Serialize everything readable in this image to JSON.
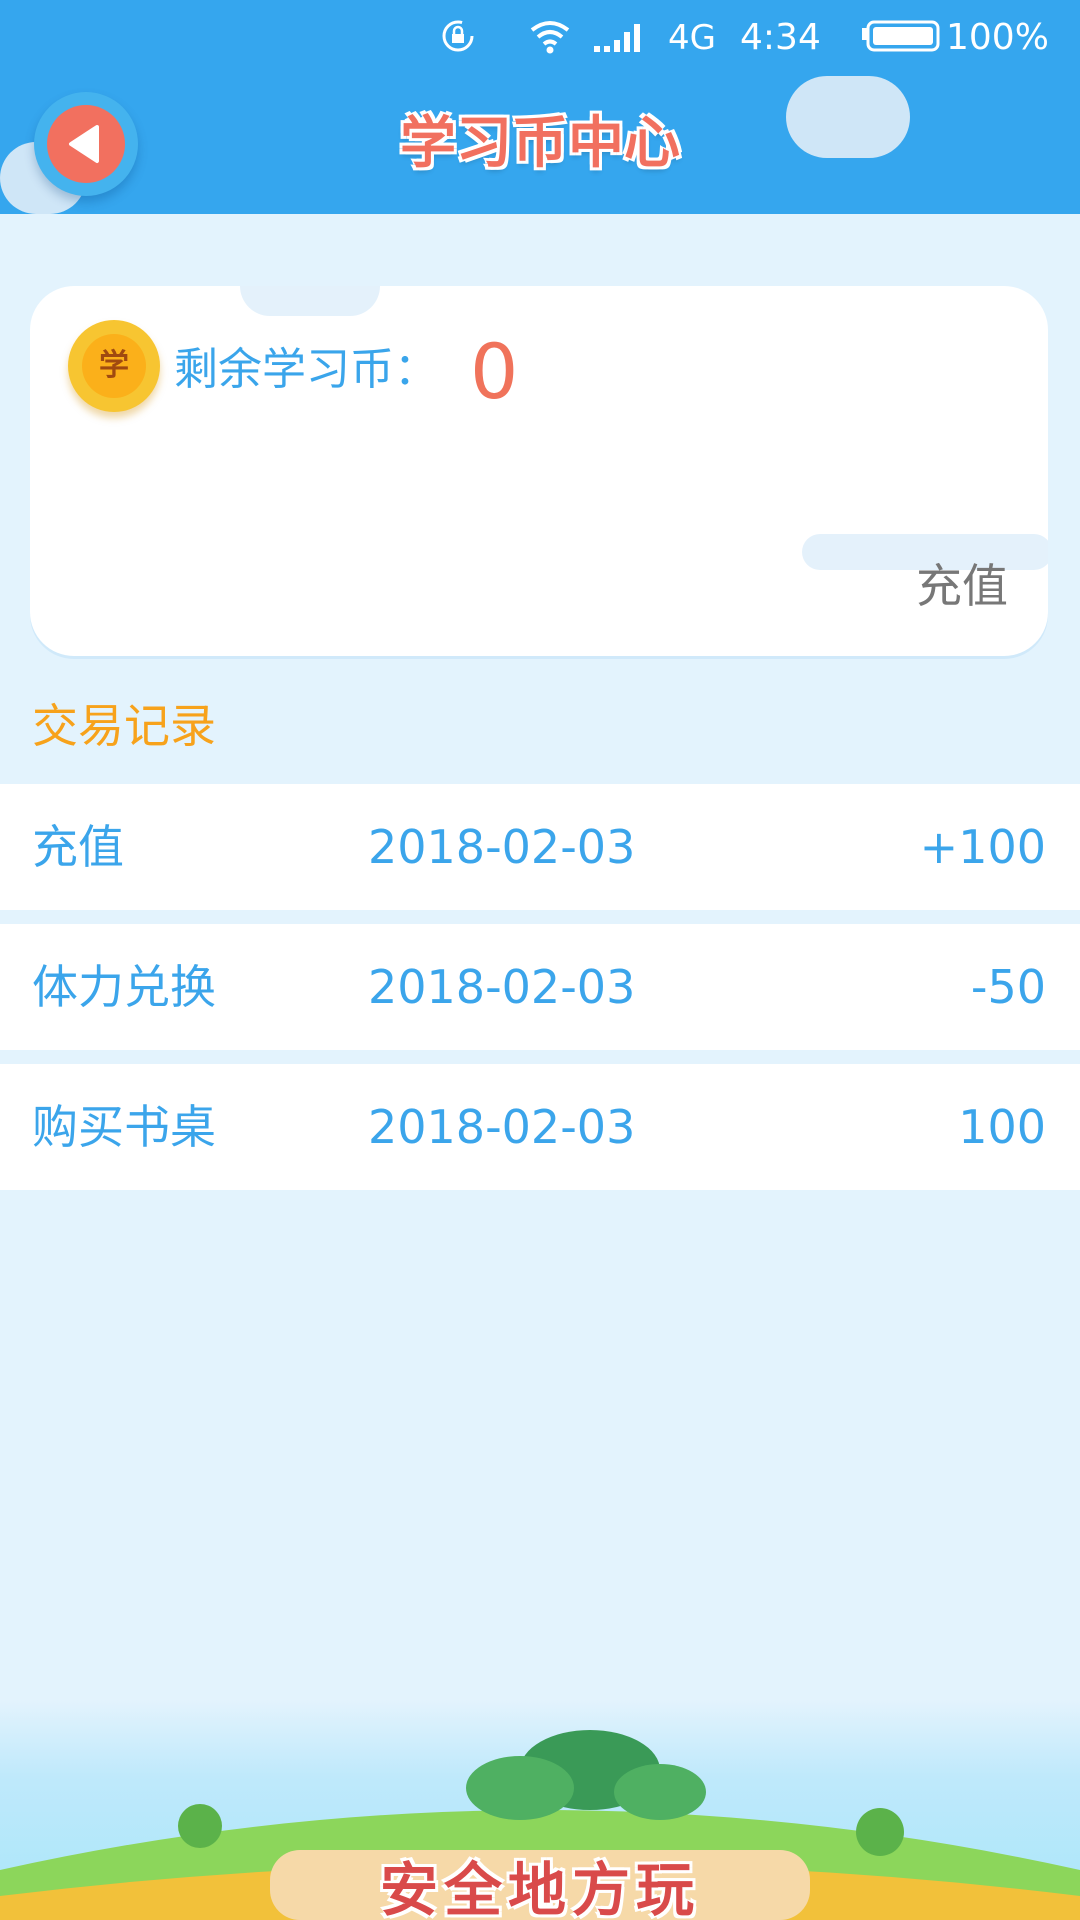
{
  "status_bar": {
    "network": "4G",
    "time": "4:34",
    "battery": "100%"
  },
  "header": {
    "title": "学习币中心"
  },
  "balance": {
    "coin_glyph": "学",
    "label": "剩余学习币：",
    "value": "0",
    "recharge_label": "充值"
  },
  "records": {
    "title": "交易记录",
    "rows": [
      {
        "name": "充值",
        "date": "2018-02-03",
        "amount": "+100"
      },
      {
        "name": "体力兑换",
        "date": "2018-02-03",
        "amount": "-50"
      },
      {
        "name": "购买书桌",
        "date": "2018-02-03",
        "amount": "100"
      }
    ]
  },
  "banner": {
    "logo_text": "安全地方玩"
  },
  "colors": {
    "header_bg": "#35a6ee",
    "page_bg": "#e3f3fd",
    "accent_red": "#f1705f",
    "text_blue": "#3ba5eb",
    "section_orange": "#f7a21b"
  }
}
